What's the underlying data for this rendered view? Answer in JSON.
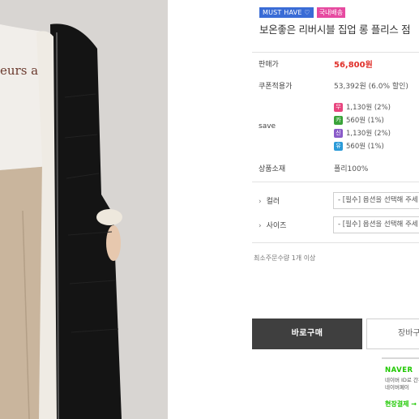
{
  "badges": {
    "must_have": "MUST HAVE ♡",
    "local": "국내배송"
  },
  "product": {
    "title": "보온좋은 리버시블 집업 롱 플리스 점"
  },
  "photo": {
    "shirt_print": "eurs am"
  },
  "price": {
    "label": "판매가",
    "value": "56,800원"
  },
  "coupon": {
    "label": "쿠폰적용가",
    "value": "53,392원 (6.0% 할인)"
  },
  "save": {
    "label": "save",
    "items": [
      {
        "icon": "무",
        "text": "1,130원 (2%)",
        "color": "#e8457f"
      },
      {
        "icon": "카",
        "text": "560원 (1%)",
        "color": "#3aa33a"
      },
      {
        "icon": "신",
        "text": "1,130원 (2%)",
        "color": "#8a5bc9"
      },
      {
        "icon": "유",
        "text": "560원 (1%)",
        "color": "#2a9ad8"
      }
    ]
  },
  "material": {
    "label": "상품소재",
    "value": "폴리100%"
  },
  "options": {
    "color": {
      "label": "컬러",
      "placeholder": "- [필수] 옵션을 선택해 주세"
    },
    "size": {
      "label": "사이즈",
      "placeholder": "- [필수] 옵션을 선택해 주세"
    }
  },
  "min_qty": "최소주문수량 1개 이상",
  "buttons": {
    "buy": "바로구매",
    "cart": "장바구"
  },
  "naver": {
    "logo": "NAVER",
    "line1": "네이버 ID로 간편",
    "line2": "네이버페이",
    "pay": "현장결제 →"
  },
  "colors": {
    "price": "#e0302a",
    "buy_button": "#3f3f3f",
    "naver_green": "#1ec800"
  }
}
